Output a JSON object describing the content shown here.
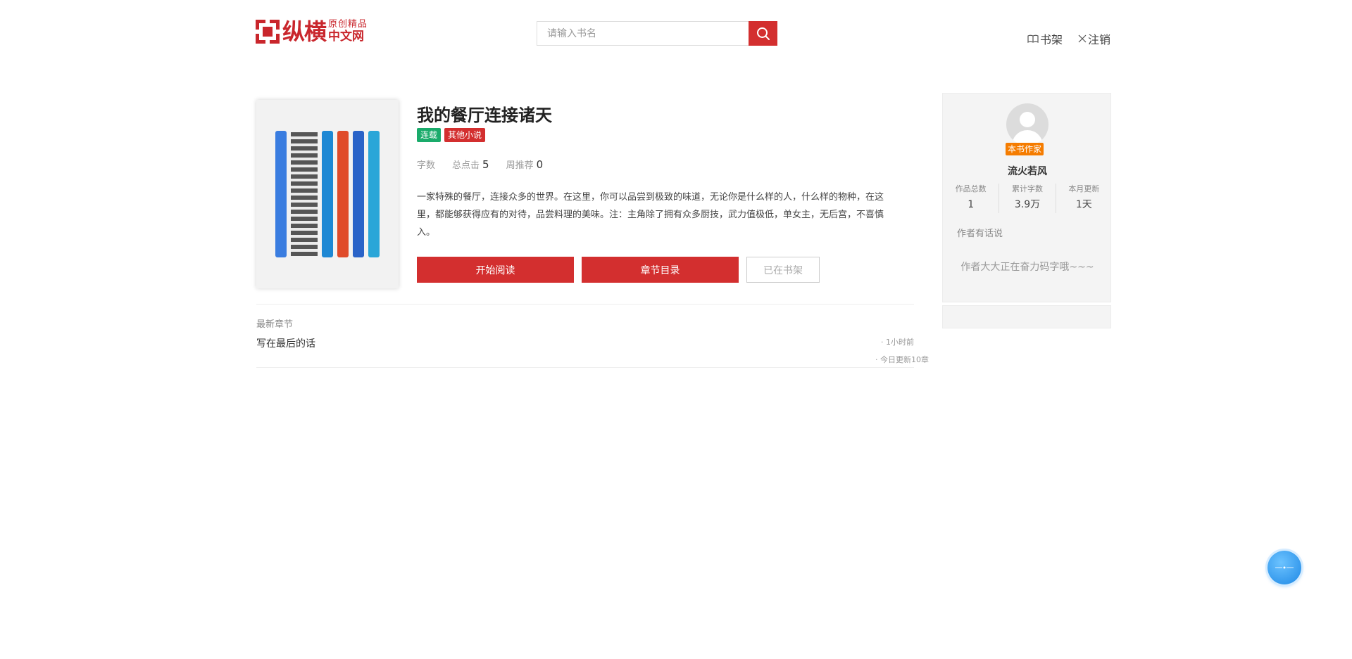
{
  "header": {
    "logo_big": "纵横",
    "logo_small_top": "原创精品",
    "logo_small_bottom": "中文网",
    "search_placeholder": "请输入书名",
    "bookshelf_label": "书架",
    "logout_label": "注销"
  },
  "book": {
    "title": "我的餐厅连接诸天",
    "tags": [
      {
        "label": "连载",
        "color": "#1aab6b"
      },
      {
        "label": "其他小说",
        "color": "#d32f2f"
      }
    ],
    "stats": {
      "words_label": "字数",
      "clicks_label": "总点击",
      "clicks_value": "5",
      "recommend_label": "周推荐",
      "recommend_value": "0"
    },
    "intro": "一家特殊的餐厅，连接众多的世界。在这里，你可以品尝到极致的味道，无论你是什么样的人，什么样的物种，在这里，都能够获得应有的对待，品尝料理的美味。注：主角除了拥有众多厨技，武力值极低，单女主，无后宫，不喜慎入。",
    "buttons": {
      "start_reading": "开始阅读",
      "chapter_list": "章节目录",
      "in_shelf": "已在书架"
    }
  },
  "latest": {
    "label": "最新章节",
    "chapter_title": "写在最后的话",
    "time": "· 1小时前",
    "today_updates": "· 今日更新10章"
  },
  "author": {
    "badge": "本书作家",
    "name": "流火若风",
    "stats": [
      {
        "label": "作品总数",
        "value": "1"
      },
      {
        "label": "累计字数",
        "value": "3.9万"
      },
      {
        "label": "本月更新",
        "value": "1天"
      }
    ],
    "words_title": "作者有话说",
    "words": "作者大大正在奋力码字哦~~~"
  },
  "colors": {
    "brand_red": "#d32f2f",
    "badge_orange": "#f57c00",
    "float_blue": "#1e88e5"
  }
}
